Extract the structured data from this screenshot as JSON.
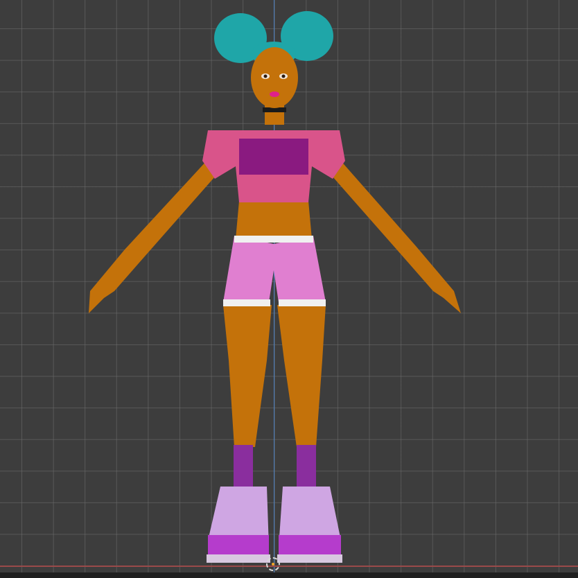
{
  "viewport": {
    "mode": "front-orthographic",
    "background_color": "#3d3d3d",
    "grid_color": "#555555",
    "axis_z_color": "#4a7fc0",
    "axis_x_color": "#9a4a4a"
  },
  "model": {
    "skin_color": "#c4720a",
    "hair_color": "#1fa6a8",
    "top_color": "#d9548a",
    "shorts_color": "#e07fd0",
    "socks_color": "#8a2e9e",
    "shoes_color": "#cfa6e3",
    "shoe_sole_color": "#b53ccc"
  },
  "icons": {
    "cursor": "3d-cursor-icon"
  }
}
